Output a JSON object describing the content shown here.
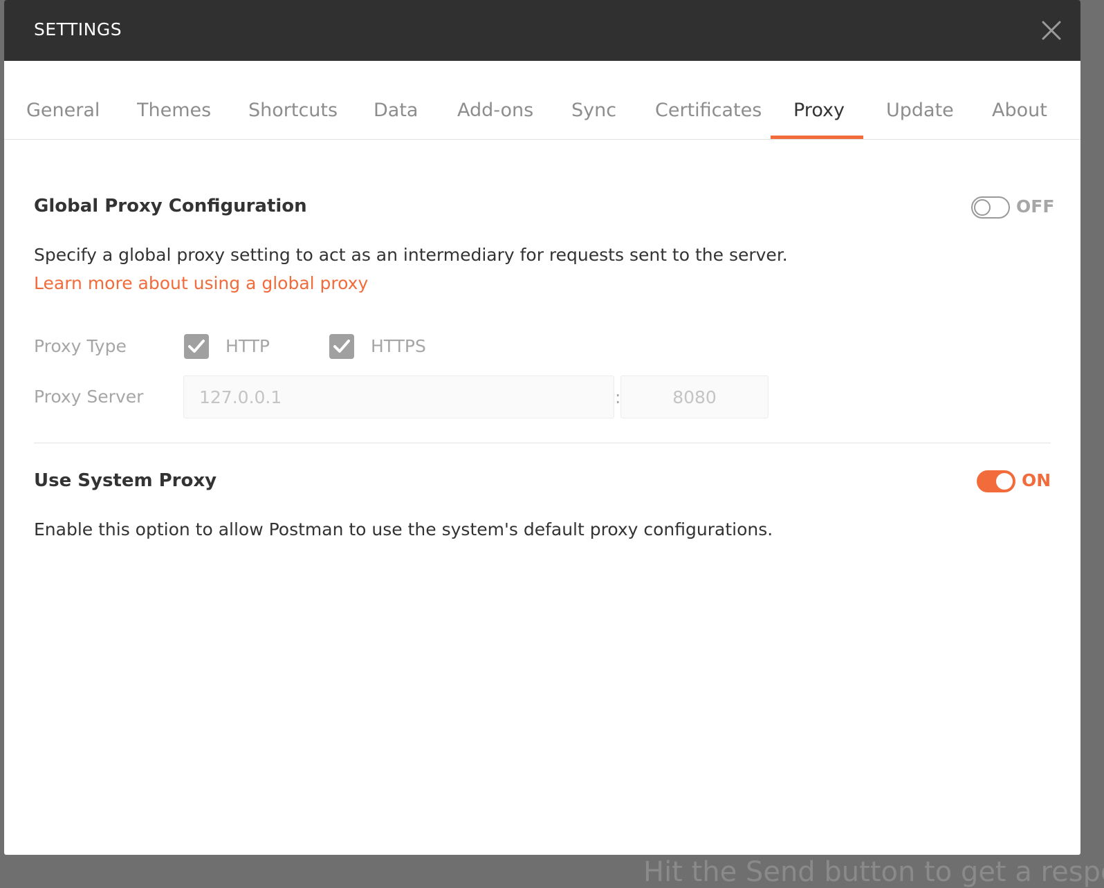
{
  "backdrop": {
    "text": "Hit the Send button to get a respons"
  },
  "modal": {
    "title": "SETTINGS",
    "close_icon": "close-icon"
  },
  "tabs": [
    {
      "label": "General"
    },
    {
      "label": "Themes"
    },
    {
      "label": "Shortcuts"
    },
    {
      "label": "Data"
    },
    {
      "label": "Add-ons"
    },
    {
      "label": "Sync"
    },
    {
      "label": "Certificates"
    },
    {
      "label": "Proxy",
      "active": true
    },
    {
      "label": "Update"
    },
    {
      "label": "About"
    }
  ],
  "global_proxy": {
    "title": "Global Proxy Configuration",
    "toggle_state": "OFF",
    "description": "Specify a global proxy setting to act as an intermediary for requests sent to the server.",
    "link_text": "Learn more about using a global proxy",
    "proxy_type_label": "Proxy Type",
    "http_label": "HTTP",
    "http_checked": true,
    "https_label": "HTTPS",
    "https_checked": true,
    "proxy_server_label": "Proxy Server",
    "server_placeholder": "127.0.0.1",
    "separator": ":",
    "port_placeholder": "8080"
  },
  "system_proxy": {
    "title": "Use System Proxy",
    "toggle_state": "ON",
    "description": "Enable this option to allow Postman to use the system's default proxy configurations."
  },
  "colors": {
    "accent": "#f26b3a",
    "header_bg": "#303030",
    "muted_text": "#a6a6a6"
  }
}
